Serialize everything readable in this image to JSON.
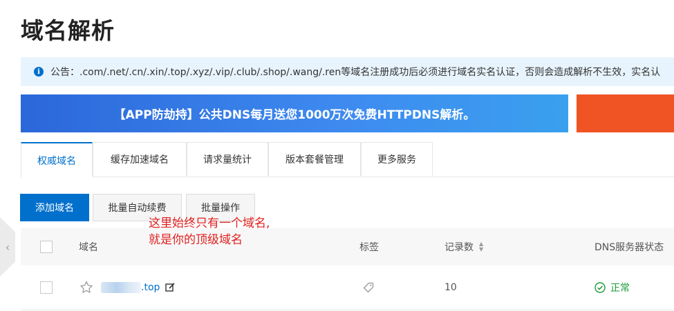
{
  "page": {
    "title": "域名解析"
  },
  "notice": {
    "icon": "info-icon",
    "text": "公告：.com/.net/.cn/.xin/.top/.xyz/.vip/.club/.shop/.wang/.ren等域名注册成功后必须进行域名实名认证，否则会造成解析不生效，实名认"
  },
  "banner": {
    "text": "【APP防劫持】公共DNS每月送您1000万次免费HTTPDNS解析。",
    "colors": {
      "blue": "#2b67d9",
      "orange": "#f05424"
    }
  },
  "tabs": [
    {
      "label": "权威域名",
      "active": true
    },
    {
      "label": "缓存加速域名",
      "active": false
    },
    {
      "label": "请求量统计",
      "active": false
    },
    {
      "label": "版本套餐管理",
      "active": false
    },
    {
      "label": "更多服务",
      "active": false
    }
  ],
  "toolbar": {
    "add": "添加域名",
    "auto_renew": "批量自动续费",
    "batch": "批量操作"
  },
  "annotation": {
    "line1": "这里始终只有一个域名,",
    "line2": "就是你的顶级域名"
  },
  "table": {
    "headers": {
      "domain": "域名",
      "tag": "标签",
      "records": "记录数",
      "dns_status": "DNS服务器状态"
    },
    "rows": [
      {
        "domain_suffix": ".top",
        "records": "10",
        "status": "正常"
      }
    ]
  },
  "accent_color": "#0070cc"
}
